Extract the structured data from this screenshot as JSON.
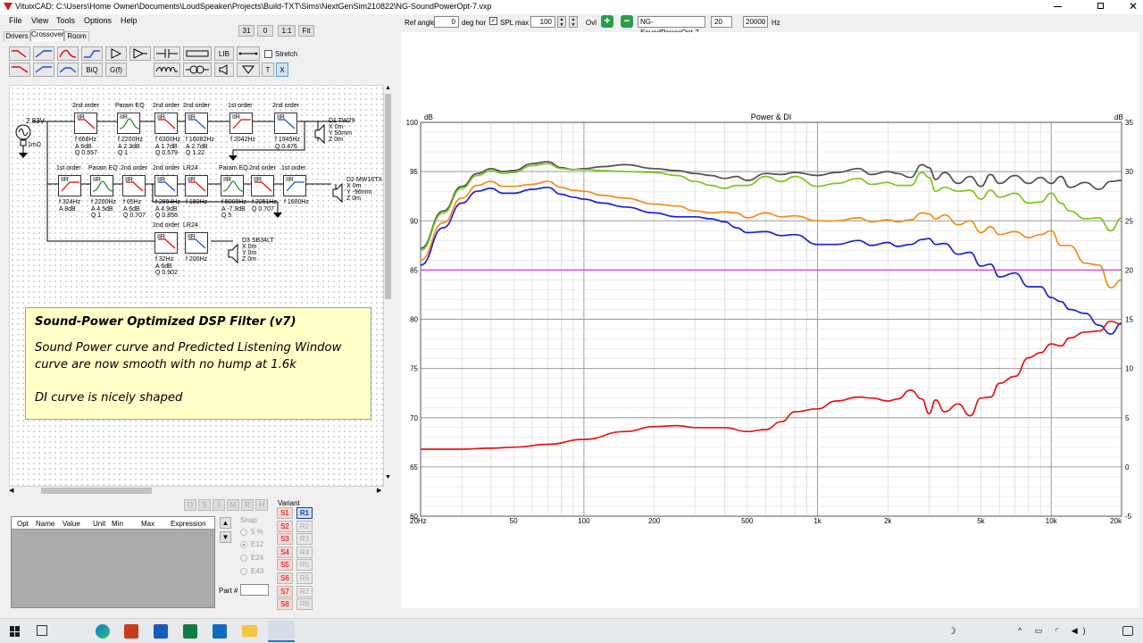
{
  "window": {
    "title": "VituixCAD: C:\\Users\\Home Owner\\Documents\\LoudSpeaker\\Projects\\Build-TXT\\Sims\\NextGenSim210822\\NG-SoundPowerOpt-7.vxp"
  },
  "menu": [
    "File",
    "View",
    "Tools",
    "Options",
    "Help"
  ],
  "tabs": [
    "Drivers",
    "Crossover",
    "Room"
  ],
  "zoom_buttons": [
    "31",
    "0",
    "1:1",
    "Fit"
  ],
  "toolbar": {
    "biq": "BiQ",
    "gf": "G(f)",
    "lib": "LIB",
    "t": "T",
    "x": "X",
    "stretch": "Stretch"
  },
  "graph_toolbar": {
    "ref_angle_label": "Ref angle",
    "ref_angle": "0",
    "deg_hor": "deg hor",
    "spl_max_label": "SPL max",
    "spl_max": "100",
    "ovl": "Ovl",
    "ovl_name": "NG-SoundPowerOpt-7",
    "f_min": "20",
    "f_max": "20000",
    "hz": "Hz"
  },
  "note": {
    "title": "Sound-Power Optimized DSP Filter (v7)",
    "line1": "Sound Power curve and Predicted Listening Window",
    "line2": "curve are now smooth with no hump at 1.6k",
    "line3": "DI curve is nicely shaped"
  },
  "circuit": {
    "source": {
      "voltage": "2.83V",
      "r": "1mΩ"
    },
    "row1": [
      {
        "type": "2nd order",
        "params": [
          "f  668Hz",
          "A  6dB",
          "Q 0.557"
        ]
      },
      {
        "type": "Param EQ",
        "params": [
          "f  2200Hz",
          "A  2.3dB",
          "Q  1"
        ]
      },
      {
        "type": "2nd order",
        "params": [
          "f  6300Hz",
          "A  1.7dB",
          "Q  0.579"
        ]
      },
      {
        "type": "2nd order",
        "params": [
          "f  16082Hz",
          "A  2.7dB",
          "Q  1.22"
        ]
      },
      {
        "type": "1st order",
        "params": [
          "f  2042Hz"
        ]
      },
      {
        "type": "2nd order",
        "params": [
          "f  1945Hz",
          "Q  0.476"
        ]
      }
    ],
    "row2": [
      {
        "type": "1st order",
        "params": [
          "f  324Hz",
          "A  8dB"
        ]
      },
      {
        "type": "Param EQ",
        "params": [
          "f  2200Hz",
          "A  4.5dB",
          "Q  1"
        ]
      },
      {
        "type": "2nd order",
        "params": [
          "f  65Hz",
          "A  6dB",
          "Q  0.707"
        ]
      },
      {
        "type": "2nd order",
        "params": [
          "f  2894Hz",
          "A  4.9dB",
          "Q  0.856"
        ]
      },
      {
        "type": "LR24",
        "params": [
          "f  180Hz"
        ]
      },
      {
        "type": "Param EQ",
        "params": [
          "f  5000Hz",
          "A  -7.9dB",
          "Q  5"
        ]
      },
      {
        "type": "2nd order",
        "params": [
          "f  2251Hz",
          "Q  0.707"
        ]
      },
      {
        "type": "1st order",
        "params": [
          "f  1600Hz"
        ]
      }
    ],
    "row3": [
      {
        "type": "2nd order",
        "params": [
          "f  32Hz",
          "A  6dB",
          "Q  0.902"
        ]
      },
      {
        "type": "LR24",
        "params": [
          "f  200Hz"
        ]
      }
    ],
    "iir": "IIR",
    "drivers": [
      {
        "name": "D1 TW29",
        "pos": [
          "X 0m",
          "Y 50mm",
          "Z 0m"
        ]
      },
      {
        "name": "D2 MW16TX",
        "pos": [
          "X 0m",
          "Y -96mm",
          "Z 0m"
        ]
      },
      {
        "name": "D3 SB34LT",
        "pos": [
          "X 0m",
          "Y 0m",
          "Z 0m"
        ]
      }
    ]
  },
  "opt_table": {
    "headers": [
      "Opt",
      "Name",
      "Value",
      "Unit",
      "Min",
      "Max",
      "Expression"
    ],
    "mode_buttons": [
      "O",
      "S",
      "I",
      "M",
      "R",
      "H"
    ]
  },
  "snap": {
    "label": "Snap",
    "options": [
      "5 %",
      "E12",
      "E24",
      "E43"
    ]
  },
  "part_label": "Part #",
  "variant": {
    "label": "Variant",
    "items": [
      "S1",
      "R1",
      "S2",
      "R2",
      "S3",
      "R3",
      "S4",
      "R4",
      "S5",
      "R5",
      "S6",
      "R6",
      "S7",
      "R7",
      "S8",
      "R8"
    ]
  },
  "chart_data": {
    "type": "line",
    "title": "Power & DI",
    "xscale": "log",
    "xlim": [
      20,
      20000
    ],
    "ylim_left": [
      60,
      100
    ],
    "ylim_right": [
      -5,
      35
    ],
    "y_unit": "dB",
    "x_ticks": [
      "20Hz",
      "50",
      "100",
      "200",
      "500",
      "1k",
      "2k",
      "5k",
      "10k",
      "20k"
    ],
    "y_ticks_left": [
      "100",
      "95",
      "90",
      "85",
      "80",
      "75",
      "70",
      "65",
      "60"
    ],
    "y_ticks_right": [
      "35",
      "30",
      "25",
      "20",
      "15",
      "10",
      "5",
      "0",
      "-5"
    ],
    "grid": true,
    "series": [
      {
        "color": "#505050",
        "x": [
          20,
          25,
          30,
          35,
          40,
          45,
          50,
          60,
          70,
          80,
          90,
          100,
          120,
          150,
          200,
          250,
          300,
          350,
          400,
          450,
          500,
          600,
          700,
          800,
          1000,
          1200,
          1500,
          1700,
          2000,
          2200,
          2500,
          2800,
          3000,
          3200,
          3500,
          4000,
          4500,
          5000,
          5500,
          6000,
          7000,
          8000,
          9000,
          10000,
          11000,
          12000,
          14000,
          16000,
          18000,
          20000
        ],
        "y": [
          87.2,
          91.0,
          93.5,
          94.8,
          95.3,
          95.0,
          95.1,
          95.8,
          96.0,
          95.4,
          95.2,
          95.3,
          95.5,
          95.7,
          95.3,
          95.1,
          94.8,
          94.6,
          94.3,
          94.5,
          94.1,
          94.8,
          94.7,
          94.9,
          94.6,
          94.9,
          95.3,
          94.7,
          95.0,
          94.8,
          94.4,
          95.7,
          95.4,
          94.2,
          94.9,
          93.8,
          94.5,
          93.5,
          94.7,
          93.8,
          94.6,
          93.8,
          94.4,
          93.8,
          94.5,
          93.4,
          93.9,
          93.2,
          94.0,
          94.1
        ]
      },
      {
        "color": "#7cc521",
        "x": [
          20,
          25,
          30,
          35,
          40,
          45,
          50,
          60,
          70,
          80,
          90,
          100,
          120,
          150,
          200,
          250,
          300,
          350,
          400,
          450,
          500,
          600,
          700,
          800,
          1000,
          1200,
          1500,
          1700,
          2000,
          2200,
          2500,
          2800,
          3000,
          3200,
          3500,
          4000,
          4500,
          5000,
          5500,
          6000,
          7000,
          8000,
          9000,
          10000,
          11000,
          12000,
          14000,
          16000,
          18000,
          20000
        ],
        "y": [
          87.0,
          90.8,
          93.3,
          94.6,
          95.1,
          94.8,
          94.9,
          95.6,
          95.8,
          95.3,
          95.2,
          95.2,
          95.1,
          95.0,
          94.9,
          94.6,
          94.0,
          93.6,
          93.3,
          93.6,
          93.6,
          94.5,
          94.0,
          94.5,
          93.5,
          93.8,
          94.3,
          93.7,
          93.9,
          93.6,
          93.6,
          94.9,
          94.4,
          93.0,
          93.4,
          93.0,
          93.1,
          92.2,
          93.1,
          92.4,
          92.8,
          91.8,
          91.9,
          92.8,
          91.8,
          91.0,
          90.2,
          90.3,
          89.0,
          90.3
        ]
      },
      {
        "color": "#f28c18",
        "x": [
          20,
          25,
          30,
          35,
          40,
          45,
          50,
          60,
          70,
          80,
          90,
          100,
          120,
          150,
          200,
          250,
          300,
          350,
          400,
          450,
          500,
          600,
          700,
          800,
          1000,
          1200,
          1500,
          1700,
          2000,
          2200,
          2500,
          2800,
          3000,
          3200,
          3500,
          4000,
          4500,
          5000,
          5500,
          6000,
          7000,
          8000,
          9000,
          10000,
          11000,
          12000,
          14000,
          16000,
          18000,
          20000
        ],
        "y": [
          86.0,
          89.8,
          92.3,
          93.6,
          94.0,
          93.5,
          93.5,
          93.7,
          94.0,
          93.4,
          93.1,
          93.0,
          92.6,
          92.3,
          91.7,
          91.5,
          91.0,
          90.8,
          90.9,
          90.8,
          90.3,
          90.8,
          90.4,
          90.5,
          90.0,
          90.0,
          90.3,
          89.9,
          90.1,
          89.9,
          90.1,
          90.8,
          90.7,
          90.2,
          90.6,
          89.6,
          90.0,
          88.8,
          89.4,
          88.6,
          88.9,
          88.3,
          88.6,
          89.0,
          87.5,
          87.5,
          85.7,
          85.5,
          83.2,
          84.0
        ]
      },
      {
        "color": "#1a22d6",
        "x": [
          20,
          25,
          30,
          35,
          40,
          45,
          50,
          60,
          70,
          80,
          90,
          100,
          120,
          150,
          200,
          250,
          300,
          350,
          400,
          450,
          500,
          600,
          700,
          800,
          1000,
          1200,
          1500,
          1700,
          2000,
          2200,
          2500,
          2800,
          3000,
          3200,
          3500,
          4000,
          4500,
          5000,
          5500,
          6000,
          7000,
          8000,
          9000,
          10000,
          11000,
          12000,
          14000,
          16000,
          18000,
          20000
        ],
        "y": [
          85.5,
          89.3,
          91.8,
          93.0,
          93.3,
          92.8,
          92.8,
          93.2,
          93.4,
          92.7,
          92.4,
          92.2,
          91.8,
          91.4,
          90.8,
          90.4,
          90.4,
          90.2,
          89.9,
          89.3,
          88.8,
          88.9,
          88.5,
          88.6,
          87.6,
          87.6,
          88.0,
          87.5,
          87.8,
          87.4,
          87.6,
          88.1,
          88.2,
          87.6,
          87.7,
          86.6,
          86.8,
          85.4,
          85.6,
          84.3,
          84.7,
          83.3,
          83.3,
          82.2,
          81.8,
          81.0,
          80.6,
          79.4,
          78.5,
          79.6
        ]
      },
      {
        "color": "#e81414",
        "x": [
          20,
          30,
          40,
          50,
          70,
          100,
          150,
          200,
          250,
          300,
          400,
          500,
          600,
          700,
          800,
          1000,
          1200,
          1500,
          1700,
          2000,
          2200,
          2500,
          2800,
          3000,
          3200,
          3500,
          4000,
          4500,
          5000,
          5500,
          6000,
          7000,
          8000,
          9000,
          10000,
          11000,
          12000,
          14000,
          16000,
          18000,
          20000
        ],
        "y": [
          66.8,
          66.8,
          66.9,
          67.0,
          67.3,
          67.8,
          68.6,
          69.1,
          69.2,
          69.0,
          69.0,
          68.6,
          68.8,
          69.6,
          70.6,
          70.9,
          71.7,
          72.1,
          72.0,
          71.7,
          71.9,
          72.8,
          71.9,
          70.4,
          71.8,
          70.6,
          71.4,
          70.2,
          72.0,
          72.1,
          73.5,
          74.2,
          76.1,
          76.6,
          77.5,
          77.3,
          78.1,
          78.7,
          78.8,
          79.8,
          79.5
        ]
      },
      {
        "color": "#d040d0",
        "x": [
          20,
          20000
        ],
        "y": [
          85.0,
          85.0
        ]
      }
    ]
  }
}
